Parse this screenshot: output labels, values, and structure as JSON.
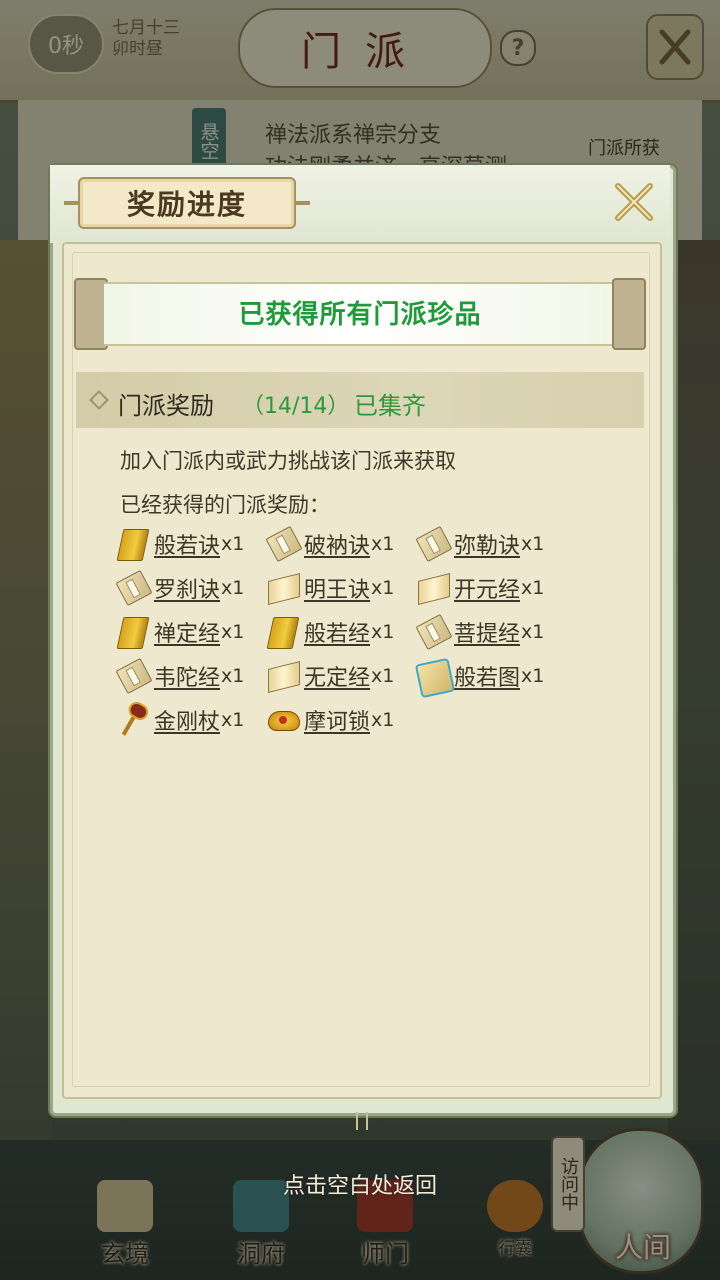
{
  "background": {
    "timer": "0秒",
    "date_line1": "七月十三",
    "date_line2": "卯时昼",
    "title": "门派",
    "help": "?",
    "sect_tag": "悬空",
    "sect_line1": "禅法派系禅宗分支",
    "sect_line2": "功法刚柔并济，高深莫测",
    "sect_reward_label": "门派所获"
  },
  "dialog": {
    "title": "奖励进度",
    "banner": "已获得所有门派珍品",
    "section": {
      "label": "门派奖励",
      "count": "（14/14）",
      "status": "已集齐"
    },
    "description": "加入门派内或武力挑战该门派来获取",
    "obtained_title": "已经获得的门派奖励："
  },
  "items": [
    {
      "name": "般若诀",
      "qty": "x1",
      "icon": "gold-book-icon"
    },
    {
      "name": "破衲诀",
      "qty": "x1",
      "icon": "tan-book-icon"
    },
    {
      "name": "弥勒诀",
      "qty": "x1",
      "icon": "tan-book-icon"
    },
    {
      "name": "罗刹诀",
      "qty": "x1",
      "icon": "tan-book-icon"
    },
    {
      "name": "明王诀",
      "qty": "x1",
      "icon": "open-book-icon"
    },
    {
      "name": "开元经",
      "qty": "x1",
      "icon": "open-book-icon"
    },
    {
      "name": "禅定经",
      "qty": "x1",
      "icon": "gold-book-icon"
    },
    {
      "name": "般若经",
      "qty": "x1",
      "icon": "gold-book-icon"
    },
    {
      "name": "菩提经",
      "qty": "x1",
      "icon": "tan-book-icon"
    },
    {
      "name": "韦陀经",
      "qty": "x1",
      "icon": "tan-book-icon"
    },
    {
      "name": "无定经",
      "qty": "x1",
      "icon": "open-book-icon"
    },
    {
      "name": "般若图",
      "qty": "x1",
      "icon": "scroll-painting-icon"
    },
    {
      "name": "金刚杖",
      "qty": "x1",
      "icon": "staff-icon"
    },
    {
      "name": "摩诃锁",
      "qty": "x1",
      "icon": "golden-lock-icon"
    }
  ],
  "hint": "点击空白处返回",
  "bottom_nav": {
    "xuanjing": "玄境",
    "dongfu": "洞府",
    "shimen": "师门",
    "xingnang": "行囊",
    "visiting": "访问中",
    "renjian": "人间"
  },
  "colors": {
    "accent_green": "#2a9a3c",
    "panel_bg": "#eee8cf",
    "dialog_bg": "#dfe6d2"
  }
}
